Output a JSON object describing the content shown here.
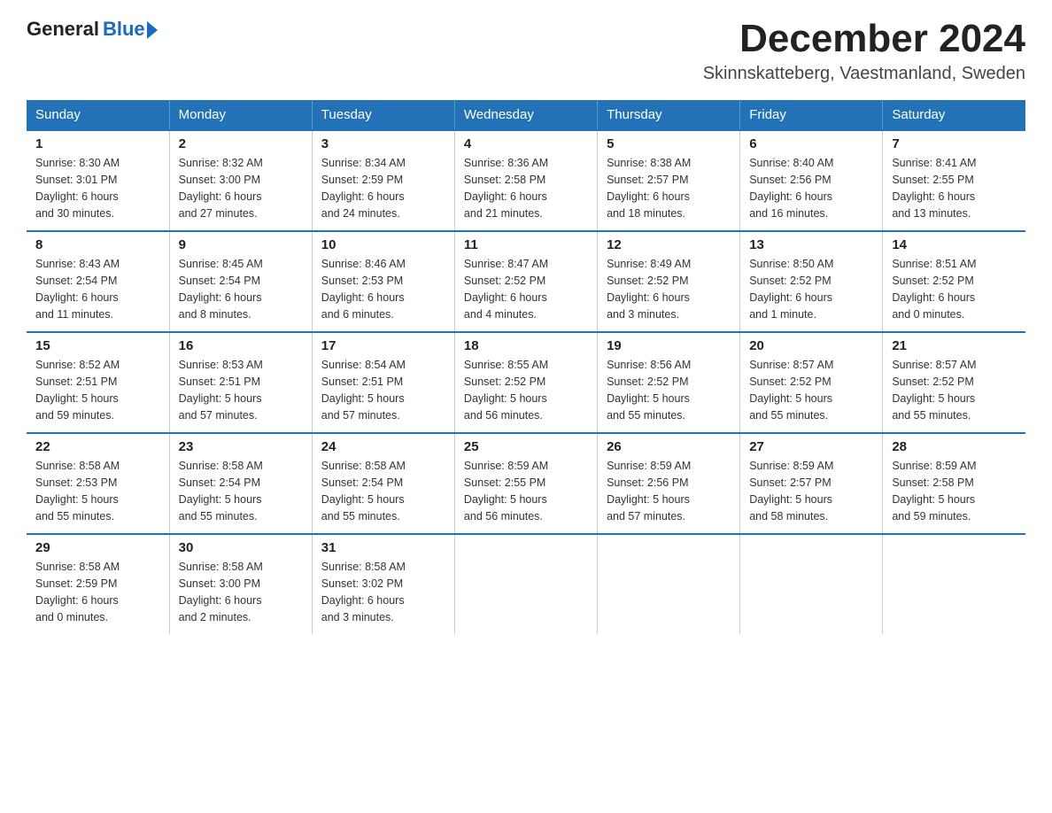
{
  "header": {
    "logo_general": "General",
    "logo_blue": "Blue",
    "month_title": "December 2024",
    "location": "Skinnskatteberg, Vaestmanland, Sweden"
  },
  "weekdays": [
    "Sunday",
    "Monday",
    "Tuesday",
    "Wednesday",
    "Thursday",
    "Friday",
    "Saturday"
  ],
  "weeks": [
    [
      {
        "day": "1",
        "info": "Sunrise: 8:30 AM\nSunset: 3:01 PM\nDaylight: 6 hours\nand 30 minutes."
      },
      {
        "day": "2",
        "info": "Sunrise: 8:32 AM\nSunset: 3:00 PM\nDaylight: 6 hours\nand 27 minutes."
      },
      {
        "day": "3",
        "info": "Sunrise: 8:34 AM\nSunset: 2:59 PM\nDaylight: 6 hours\nand 24 minutes."
      },
      {
        "day": "4",
        "info": "Sunrise: 8:36 AM\nSunset: 2:58 PM\nDaylight: 6 hours\nand 21 minutes."
      },
      {
        "day": "5",
        "info": "Sunrise: 8:38 AM\nSunset: 2:57 PM\nDaylight: 6 hours\nand 18 minutes."
      },
      {
        "day": "6",
        "info": "Sunrise: 8:40 AM\nSunset: 2:56 PM\nDaylight: 6 hours\nand 16 minutes."
      },
      {
        "day": "7",
        "info": "Sunrise: 8:41 AM\nSunset: 2:55 PM\nDaylight: 6 hours\nand 13 minutes."
      }
    ],
    [
      {
        "day": "8",
        "info": "Sunrise: 8:43 AM\nSunset: 2:54 PM\nDaylight: 6 hours\nand 11 minutes."
      },
      {
        "day": "9",
        "info": "Sunrise: 8:45 AM\nSunset: 2:54 PM\nDaylight: 6 hours\nand 8 minutes."
      },
      {
        "day": "10",
        "info": "Sunrise: 8:46 AM\nSunset: 2:53 PM\nDaylight: 6 hours\nand 6 minutes."
      },
      {
        "day": "11",
        "info": "Sunrise: 8:47 AM\nSunset: 2:52 PM\nDaylight: 6 hours\nand 4 minutes."
      },
      {
        "day": "12",
        "info": "Sunrise: 8:49 AM\nSunset: 2:52 PM\nDaylight: 6 hours\nand 3 minutes."
      },
      {
        "day": "13",
        "info": "Sunrise: 8:50 AM\nSunset: 2:52 PM\nDaylight: 6 hours\nand 1 minute."
      },
      {
        "day": "14",
        "info": "Sunrise: 8:51 AM\nSunset: 2:52 PM\nDaylight: 6 hours\nand 0 minutes."
      }
    ],
    [
      {
        "day": "15",
        "info": "Sunrise: 8:52 AM\nSunset: 2:51 PM\nDaylight: 5 hours\nand 59 minutes."
      },
      {
        "day": "16",
        "info": "Sunrise: 8:53 AM\nSunset: 2:51 PM\nDaylight: 5 hours\nand 57 minutes."
      },
      {
        "day": "17",
        "info": "Sunrise: 8:54 AM\nSunset: 2:51 PM\nDaylight: 5 hours\nand 57 minutes."
      },
      {
        "day": "18",
        "info": "Sunrise: 8:55 AM\nSunset: 2:52 PM\nDaylight: 5 hours\nand 56 minutes."
      },
      {
        "day": "19",
        "info": "Sunrise: 8:56 AM\nSunset: 2:52 PM\nDaylight: 5 hours\nand 55 minutes."
      },
      {
        "day": "20",
        "info": "Sunrise: 8:57 AM\nSunset: 2:52 PM\nDaylight: 5 hours\nand 55 minutes."
      },
      {
        "day": "21",
        "info": "Sunrise: 8:57 AM\nSunset: 2:52 PM\nDaylight: 5 hours\nand 55 minutes."
      }
    ],
    [
      {
        "day": "22",
        "info": "Sunrise: 8:58 AM\nSunset: 2:53 PM\nDaylight: 5 hours\nand 55 minutes."
      },
      {
        "day": "23",
        "info": "Sunrise: 8:58 AM\nSunset: 2:54 PM\nDaylight: 5 hours\nand 55 minutes."
      },
      {
        "day": "24",
        "info": "Sunrise: 8:58 AM\nSunset: 2:54 PM\nDaylight: 5 hours\nand 55 minutes."
      },
      {
        "day": "25",
        "info": "Sunrise: 8:59 AM\nSunset: 2:55 PM\nDaylight: 5 hours\nand 56 minutes."
      },
      {
        "day": "26",
        "info": "Sunrise: 8:59 AM\nSunset: 2:56 PM\nDaylight: 5 hours\nand 57 minutes."
      },
      {
        "day": "27",
        "info": "Sunrise: 8:59 AM\nSunset: 2:57 PM\nDaylight: 5 hours\nand 58 minutes."
      },
      {
        "day": "28",
        "info": "Sunrise: 8:59 AM\nSunset: 2:58 PM\nDaylight: 5 hours\nand 59 minutes."
      }
    ],
    [
      {
        "day": "29",
        "info": "Sunrise: 8:58 AM\nSunset: 2:59 PM\nDaylight: 6 hours\nand 0 minutes."
      },
      {
        "day": "30",
        "info": "Sunrise: 8:58 AM\nSunset: 3:00 PM\nDaylight: 6 hours\nand 2 minutes."
      },
      {
        "day": "31",
        "info": "Sunrise: 8:58 AM\nSunset: 3:02 PM\nDaylight: 6 hours\nand 3 minutes."
      },
      {
        "day": "",
        "info": ""
      },
      {
        "day": "",
        "info": ""
      },
      {
        "day": "",
        "info": ""
      },
      {
        "day": "",
        "info": ""
      }
    ]
  ]
}
